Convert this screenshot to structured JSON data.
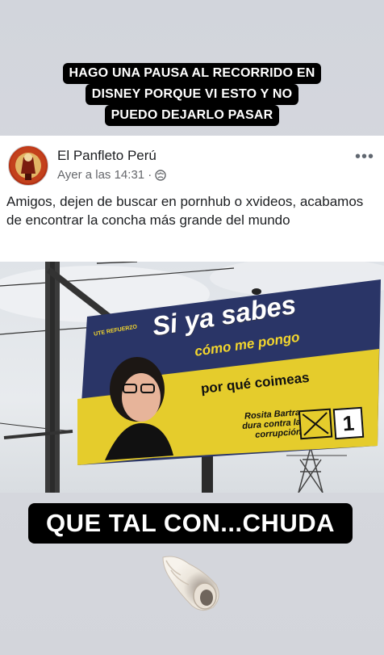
{
  "story": {
    "caption_top_lines": [
      "HAGO UNA PAUSA AL RECORRIDO EN",
      "DISNEY PORQUE VI ESTO Y NO",
      "PUEDO DEJARLO PASAR"
    ],
    "caption_bottom": "QUE TAL CON...CHUDA",
    "sticker_icon": "spiral-shell-icon"
  },
  "post": {
    "page_name": "El Panfleto Perú",
    "timestamp": "Ayer a las 14:31 ·",
    "privacy_icon": "globe-icon",
    "more_label": "•••",
    "text": "Amigos, dejen de buscar en pornhub o xvideos, acabamos de encontrar la concha más grande del mundo"
  },
  "billboard": {
    "headline": "Si ya sabes",
    "subline": "cómo me pongo",
    "line3": "por qué coimeas",
    "name_line1": "Rosita Bartra",
    "name_line2": "dura contra la",
    "name_line3": "corrupción",
    "number": "1",
    "tag": "UTE REFUERZO"
  },
  "colors": {
    "billboard_blue": "#2a3567",
    "billboard_yellow": "#e5cc2c",
    "caption_bg": "#000000"
  }
}
